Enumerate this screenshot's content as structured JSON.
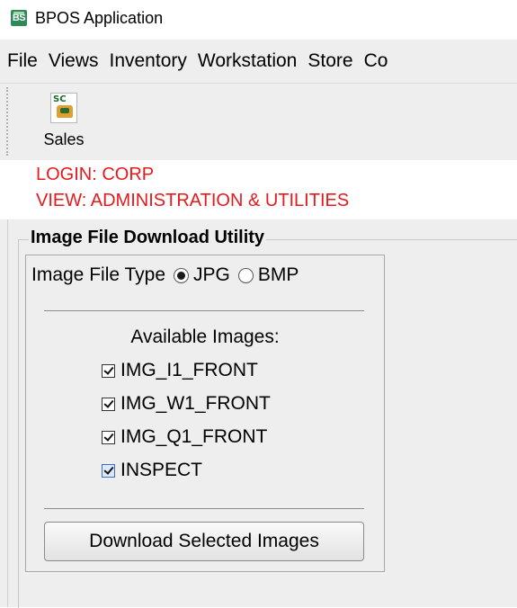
{
  "window": {
    "title": "BPOS Application",
    "icon_text": "BS",
    "icon": "bpos-app-icon"
  },
  "menu": {
    "items": [
      "File",
      "Views",
      "Inventory",
      "Workstation",
      "Store",
      "Co"
    ]
  },
  "toolbar": {
    "sales_label": "Sales",
    "sales_icon_text": "SC",
    "sales_icon": "sales-icon"
  },
  "info": {
    "login": "LOGIN: CORP",
    "view": "VIEW: ADMINISTRATION & UTILITIES",
    "color": "#e8191c"
  },
  "utility": {
    "title": "Image File Download Utility",
    "type_label": "Image File Type",
    "types": [
      {
        "label": "JPG",
        "selected": true
      },
      {
        "label": "BMP",
        "selected": false
      }
    ],
    "available_label": "Available Images:",
    "images": [
      {
        "label": "IMG_I1_FRONT",
        "checked": true
      },
      {
        "label": "IMG_W1_FRONT",
        "checked": true
      },
      {
        "label": "IMG_Q1_FRONT",
        "checked": true
      },
      {
        "label": "INSPECT",
        "checked": true,
        "focused": true
      }
    ],
    "download_label": "Download Selected Images"
  }
}
